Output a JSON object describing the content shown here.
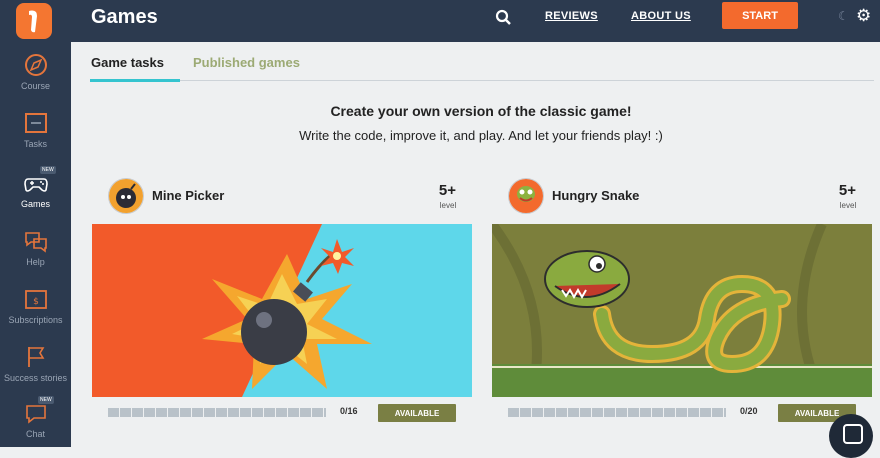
{
  "header": {
    "title": "Games",
    "nav": {
      "reviews": "REVIEWS",
      "about": "ABOUT US",
      "start": "START"
    },
    "icons": [
      "logo-icon",
      "search-icon",
      "moon-icon",
      "gear-icon"
    ]
  },
  "sidebar": {
    "items": [
      {
        "label": "Course",
        "icon": "compass-icon"
      },
      {
        "label": "Tasks",
        "icon": "tasks-icon"
      },
      {
        "label": "Games",
        "icon": "gamepad-icon",
        "badge": "NEW"
      },
      {
        "label": "Help",
        "icon": "help-icon"
      },
      {
        "label": "Subscriptions",
        "icon": "subscription-icon"
      },
      {
        "label": "Success stories",
        "icon": "flag-icon"
      },
      {
        "label": "Chat",
        "icon": "chat-icon",
        "badge": "NEW"
      }
    ]
  },
  "tabs": [
    {
      "label": "Game tasks",
      "active": true
    },
    {
      "label": "Published games",
      "active": false
    }
  ],
  "intro": {
    "title": "Create your own version of the classic game!",
    "subtitle": "Write the code, improve it, and play. And let your friends play! :)"
  },
  "games": [
    {
      "name": "Mine Picker",
      "age": "5+",
      "age_label": "level",
      "progress_text": "0/16",
      "status": "AVAILABLE",
      "progress": 0
    },
    {
      "name": "Hungry Snake",
      "age": "5+",
      "age_label": "level",
      "progress_text": "0/20",
      "status": "AVAILABLE",
      "progress": 0
    }
  ],
  "colors": {
    "accent": "#f36a2d",
    "nav": "#2c3a4f",
    "tab_underline": "#34c4cf",
    "available": "#7a7f44"
  }
}
